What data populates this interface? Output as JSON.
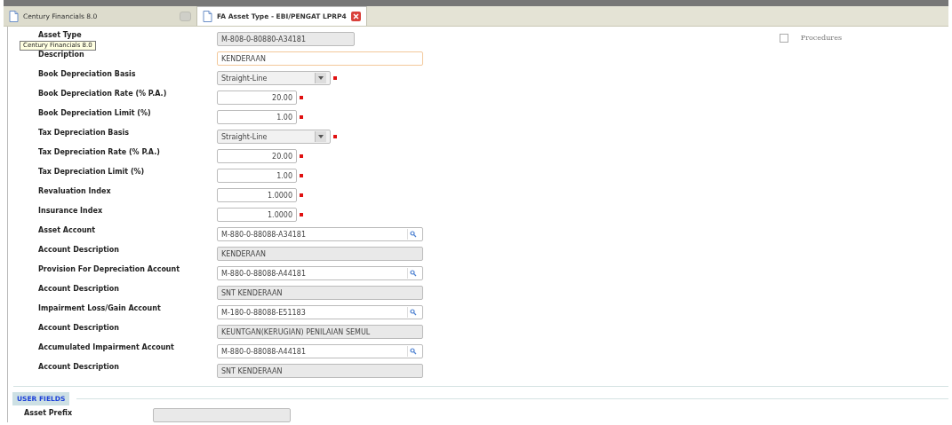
{
  "tabs": [
    {
      "label": "Century Financials 8.0",
      "selected": false,
      "closable": false
    },
    {
      "label": "FA Asset Type - EBI/PENGAT LPRP4",
      "selected": true,
      "closable": true
    }
  ],
  "tooltip": "Century Financials 8.0",
  "procedures": {
    "label": "Procedures",
    "checked": false
  },
  "fields": [
    {
      "label": "Asset Type",
      "kind": "key",
      "value": "M-808-0-80880-A34181",
      "required": false
    },
    {
      "label": "Description",
      "kind": "text",
      "value": "KENDERAAN",
      "required": false
    },
    {
      "label": "Book Depreciation Basis",
      "kind": "select",
      "value": "Straight-Line",
      "required": true
    },
    {
      "label": "Book Depreciation Rate (% P.A.)",
      "kind": "number",
      "value": "20.00",
      "required": true
    },
    {
      "label": "Book Depreciation Limit (%)",
      "kind": "number",
      "value": "1.00",
      "required": true
    },
    {
      "label": "Tax Depreciation Basis",
      "kind": "select",
      "value": "Straight-Line",
      "required": true
    },
    {
      "label": "Tax Depreciation Rate (% P.A.)",
      "kind": "number",
      "value": "20.00",
      "required": true
    },
    {
      "label": "Tax Depreciation Limit (%)",
      "kind": "number",
      "value": "1.00",
      "required": true
    },
    {
      "label": "Revaluation Index",
      "kind": "number",
      "value": "1.0000",
      "required": true
    },
    {
      "label": "Insurance Index",
      "kind": "number",
      "value": "1.0000",
      "required": true
    },
    {
      "label": "Asset Account",
      "kind": "lookup",
      "value": "M-880-0-88088-A34181",
      "required": false
    },
    {
      "label": "Account Description",
      "kind": "readonly",
      "value": "KENDERAAN",
      "required": false
    },
    {
      "label": "Provision For Depreciation Account",
      "kind": "lookup",
      "value": "M-880-0-88088-A44181",
      "required": false
    },
    {
      "label": "Account Description",
      "kind": "readonly",
      "value": "SNT KENDERAAN",
      "required": false
    },
    {
      "label": "Impairment Loss/Gain Account",
      "kind": "lookup",
      "value": "M-180-0-88088-E51183",
      "required": false
    },
    {
      "label": "Account Description",
      "kind": "readonly",
      "value": "KEUNTGAN(KERUGIAN) PENILAIAN SEMUL",
      "required": false
    },
    {
      "label": "Accumulated Impairment Account",
      "kind": "lookup",
      "value": "M-880-0-88088-A44181",
      "required": false
    },
    {
      "label": "Account Description",
      "kind": "readonly",
      "value": "SNT KENDERAAN",
      "required": false
    }
  ],
  "user_fields": {
    "title": "USER FIELDS",
    "fields": [
      {
        "label": "Asset Prefix",
        "kind": "key",
        "required": false
      }
    ]
  }
}
